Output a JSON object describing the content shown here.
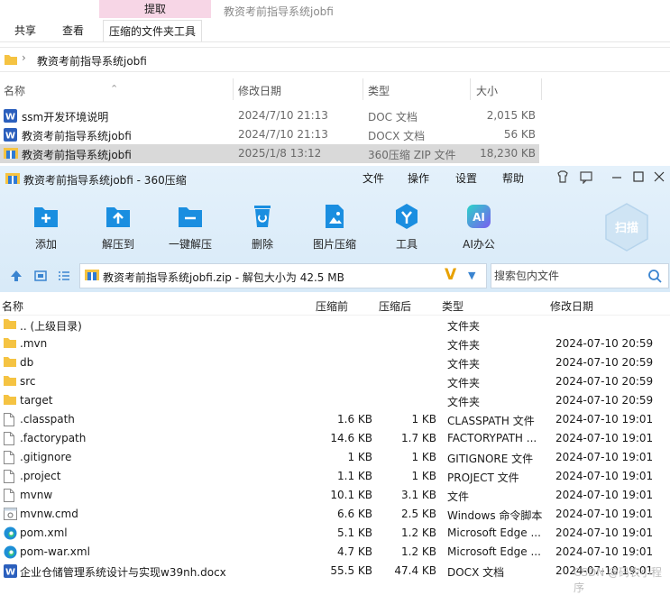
{
  "explorer": {
    "context_tab": "提取",
    "title": "教资考前指导系统jobfi",
    "tabs": {
      "share": "共享",
      "view": "查看",
      "compressed": "压缩的文件夹工具"
    },
    "path": "教资考前指导系统jobfi",
    "columns": {
      "name": "名称",
      "date": "修改日期",
      "type": "类型",
      "size": "大小"
    },
    "files": [
      {
        "icon": "word",
        "name": "ssm开发环境说明",
        "date": "2024/7/10 21:13",
        "type": "DOC 文档",
        "size": "2,015 KB",
        "selected": false
      },
      {
        "icon": "word",
        "name": "教资考前指导系统jobfi",
        "date": "2024/7/10 21:13",
        "type": "DOCX 文档",
        "size": "56 KB",
        "selected": false
      },
      {
        "icon": "zip",
        "name": "教资考前指导系统jobfi",
        "date": "2025/1/8 13:12",
        "type": "360压缩 ZIP 文件",
        "size": "18,230 KB",
        "selected": true
      }
    ]
  },
  "zip": {
    "title": "教资考前指导系统jobfi - 360压缩",
    "menu": {
      "file": "文件",
      "ops": "操作",
      "settings": "设置",
      "help": "帮助"
    },
    "toolbar": {
      "add": "添加",
      "extract_to": "解压到",
      "one_click": "一键解压",
      "delete": "删除",
      "image_compress": "图片压缩",
      "tools": "工具",
      "ai_office": "AI办公",
      "scan": "扫描"
    },
    "colors": {
      "accent": "#1a8ee0",
      "folder": "#f5c342",
      "word": "#2b5fbd"
    },
    "path_text": "教资考前指导系统jobfi.zip - 解包大小为 42.5 MB",
    "search_placeholder": "搜索包内文件",
    "columns": {
      "name": "名称",
      "before": "压缩前",
      "after": "压缩后",
      "type": "类型",
      "date": "修改日期"
    },
    "rows": [
      {
        "icon": "folder",
        "name": ".. (上级目录)",
        "before": "",
        "after": "",
        "type": "文件夹",
        "date": ""
      },
      {
        "icon": "folder",
        "name": ".mvn",
        "before": "",
        "after": "",
        "type": "文件夹",
        "date": "2024-07-10 20:59"
      },
      {
        "icon": "folder",
        "name": "db",
        "before": "",
        "after": "",
        "type": "文件夹",
        "date": "2024-07-10 20:59"
      },
      {
        "icon": "folder",
        "name": "src",
        "before": "",
        "after": "",
        "type": "文件夹",
        "date": "2024-07-10 20:59"
      },
      {
        "icon": "folder",
        "name": "target",
        "before": "",
        "after": "",
        "type": "文件夹",
        "date": "2024-07-10 20:59"
      },
      {
        "icon": "file",
        "name": ".classpath",
        "before": "1.6 KB",
        "after": "1 KB",
        "type": "CLASSPATH 文件",
        "date": "2024-07-10 19:01"
      },
      {
        "icon": "file",
        "name": ".factorypath",
        "before": "14.6 KB",
        "after": "1.7 KB",
        "type": "FACTORYPATH ...",
        "date": "2024-07-10 19:01"
      },
      {
        "icon": "file",
        "name": ".gitignore",
        "before": "1 KB",
        "after": "1 KB",
        "type": "GITIGNORE 文件",
        "date": "2024-07-10 19:01"
      },
      {
        "icon": "file",
        "name": ".project",
        "before": "1.1 KB",
        "after": "1 KB",
        "type": "PROJECT 文件",
        "date": "2024-07-10 19:01"
      },
      {
        "icon": "file",
        "name": "mvnw",
        "before": "10.1 KB",
        "after": "3.1 KB",
        "type": "文件",
        "date": "2024-07-10 19:01"
      },
      {
        "icon": "cmd",
        "name": "mvnw.cmd",
        "before": "6.6 KB",
        "after": "2.5 KB",
        "type": "Windows 命令脚本",
        "date": "2024-07-10 19:01"
      },
      {
        "icon": "edge",
        "name": "pom.xml",
        "before": "5.1 KB",
        "after": "1.2 KB",
        "type": "Microsoft Edge ...",
        "date": "2024-07-10 19:01"
      },
      {
        "icon": "edge",
        "name": "pom-war.xml",
        "before": "4.7 KB",
        "after": "1.2 KB",
        "type": "Microsoft Edge ...",
        "date": "2024-07-10 19:01"
      },
      {
        "icon": "word",
        "name": "企业仓储管理系统设计与实现w39nh.docx",
        "before": "55.5 KB",
        "after": "47.4 KB",
        "type": "DOCX 文档",
        "date": "2024-07-10 19:01"
      }
    ],
    "watermark": "CSDN @码农小程序"
  }
}
